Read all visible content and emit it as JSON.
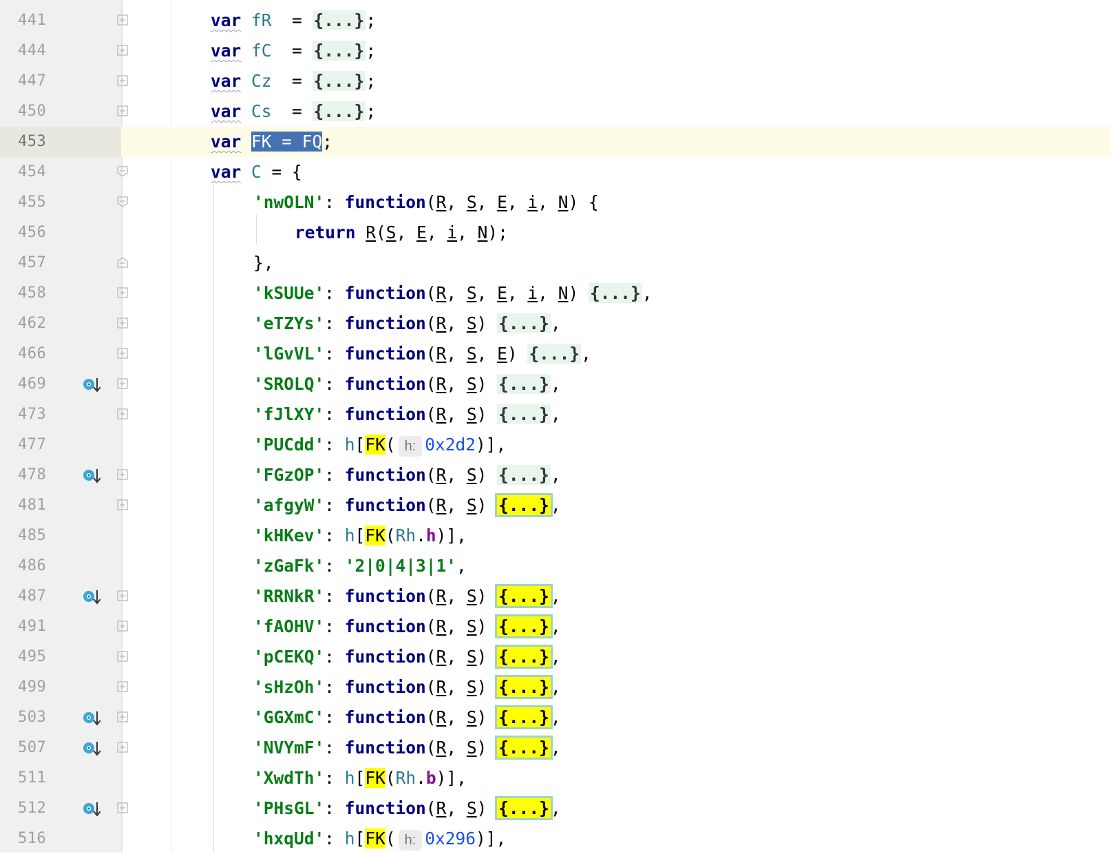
{
  "lines": [
    {
      "num": "441",
      "tokens": [
        [
          "kw",
          "var"
        ],
        [
          "var",
          " fR"
        ],
        [
          "",
          "  = "
        ],
        [
          "fold",
          "{...}"
        ],
        [
          "",
          ";"
        ]
      ]
    },
    {
      "num": "444",
      "tokens": [
        [
          "kw",
          "var"
        ],
        [
          "var",
          " fC"
        ],
        [
          "",
          "  = "
        ],
        [
          "fold",
          "{...}"
        ],
        [
          "",
          ";"
        ]
      ]
    },
    {
      "num": "447",
      "tokens": [
        [
          "kw",
          "var"
        ],
        [
          "var",
          " Cz"
        ],
        [
          "",
          "  = "
        ],
        [
          "fold",
          "{...}"
        ],
        [
          "",
          ";"
        ]
      ]
    },
    {
      "num": "450",
      "tokens": [
        [
          "kw",
          "var"
        ],
        [
          "var",
          " Cs"
        ],
        [
          "",
          "  = "
        ],
        [
          "fold",
          "{...}"
        ],
        [
          "",
          ";"
        ]
      ]
    },
    {
      "num": "453",
      "current": true,
      "tokens": [
        [
          "kw",
          "var"
        ],
        [
          "",
          " "
        ],
        [
          "sel",
          "FK = FQ"
        ],
        [
          "",
          ";"
        ]
      ]
    },
    {
      "num": "454",
      "tokens": [
        [
          "kw",
          "var"
        ],
        [
          "var",
          " C"
        ],
        [
          "",
          " = {"
        ]
      ]
    },
    {
      "num": "455",
      "indent": 1,
      "tokens": [
        [
          "str",
          "'nwOLN'"
        ],
        [
          "",
          ": "
        ],
        [
          "kw",
          "function"
        ],
        [
          "",
          "("
        ],
        [
          "param",
          "R"
        ],
        [
          "",
          ", "
        ],
        [
          "param",
          "S"
        ],
        [
          "",
          ", "
        ],
        [
          "param",
          "E"
        ],
        [
          "",
          ", "
        ],
        [
          "param",
          "i"
        ],
        [
          "",
          ", "
        ],
        [
          "param",
          "N"
        ],
        [
          "",
          ") {"
        ]
      ]
    },
    {
      "num": "456",
      "indent": 2,
      "tokens": [
        [
          "kw",
          "return "
        ],
        [
          "param",
          "R"
        ],
        [
          "",
          "("
        ],
        [
          "param",
          "S"
        ],
        [
          "",
          ", "
        ],
        [
          "param",
          "E"
        ],
        [
          "",
          ", "
        ],
        [
          "param",
          "i"
        ],
        [
          "",
          ", "
        ],
        [
          "param",
          "N"
        ],
        [
          "",
          ");"
        ]
      ]
    },
    {
      "num": "457",
      "indent": 1,
      "tokens": [
        [
          "",
          "},"
        ]
      ]
    },
    {
      "num": "458",
      "indent": 1,
      "tokens": [
        [
          "str",
          "'kSUUe'"
        ],
        [
          "",
          ": "
        ],
        [
          "kw",
          "function"
        ],
        [
          "",
          "("
        ],
        [
          "param",
          "R"
        ],
        [
          "",
          ", "
        ],
        [
          "param",
          "S"
        ],
        [
          "",
          ", "
        ],
        [
          "param",
          "E"
        ],
        [
          "",
          ", "
        ],
        [
          "param",
          "i"
        ],
        [
          "",
          ", "
        ],
        [
          "param",
          "N"
        ],
        [
          "",
          ") "
        ],
        [
          "fold",
          "{...}"
        ],
        [
          "",
          ","
        ]
      ]
    },
    {
      "num": "462",
      "indent": 1,
      "tokens": [
        [
          "str",
          "'eTZYs'"
        ],
        [
          "",
          ": "
        ],
        [
          "kw",
          "function"
        ],
        [
          "",
          "("
        ],
        [
          "param",
          "R"
        ],
        [
          "",
          ", "
        ],
        [
          "param",
          "S"
        ],
        [
          "",
          ") "
        ],
        [
          "fold",
          "{...}"
        ],
        [
          "",
          ","
        ]
      ]
    },
    {
      "num": "466",
      "indent": 1,
      "tokens": [
        [
          "str",
          "'lGvVL'"
        ],
        [
          "",
          ": "
        ],
        [
          "kw",
          "function"
        ],
        [
          "",
          "("
        ],
        [
          "param",
          "R"
        ],
        [
          "",
          ", "
        ],
        [
          "param",
          "S"
        ],
        [
          "",
          ", "
        ],
        [
          "param",
          "E"
        ],
        [
          "",
          ") "
        ],
        [
          "fold",
          "{...}"
        ],
        [
          "",
          ","
        ]
      ]
    },
    {
      "num": "469",
      "bookmark": true,
      "indent": 1,
      "tokens": [
        [
          "str",
          "'SROLQ'"
        ],
        [
          "",
          ": "
        ],
        [
          "kw",
          "function"
        ],
        [
          "",
          "("
        ],
        [
          "param",
          "R"
        ],
        [
          "",
          ", "
        ],
        [
          "param",
          "S"
        ],
        [
          "",
          ") "
        ],
        [
          "fold",
          "{...}"
        ],
        [
          "",
          ","
        ]
      ]
    },
    {
      "num": "473",
      "indent": 1,
      "tokens": [
        [
          "str",
          "'fJlXY'"
        ],
        [
          "",
          ": "
        ],
        [
          "kw",
          "function"
        ],
        [
          "",
          "("
        ],
        [
          "param",
          "R"
        ],
        [
          "",
          ", "
        ],
        [
          "param",
          "S"
        ],
        [
          "",
          ") "
        ],
        [
          "fold",
          "{...}"
        ],
        [
          "",
          ","
        ]
      ]
    },
    {
      "num": "477",
      "indent": 1,
      "tokens": [
        [
          "str",
          "'PUCdd'"
        ],
        [
          "",
          ": "
        ],
        [
          "var",
          "h"
        ],
        [
          "",
          "["
        ],
        [
          "hl",
          "FK"
        ],
        [
          "",
          "("
        ],
        [
          "hint",
          "h:"
        ],
        [
          "num",
          "0x2d2"
        ],
        [
          "",
          ")],"
        ]
      ]
    },
    {
      "num": "478",
      "bookmark": true,
      "indent": 1,
      "tokens": [
        [
          "str",
          "'FGzOP'"
        ],
        [
          "",
          ": "
        ],
        [
          "kw",
          "function"
        ],
        [
          "",
          "("
        ],
        [
          "param",
          "R"
        ],
        [
          "",
          ", "
        ],
        [
          "param",
          "S"
        ],
        [
          "",
          ") "
        ],
        [
          "fold",
          "{...}"
        ],
        [
          "",
          ","
        ]
      ]
    },
    {
      "num": "481",
      "indent": 1,
      "tokens": [
        [
          "str",
          "'afgyW'"
        ],
        [
          "",
          ": "
        ],
        [
          "kw",
          "function"
        ],
        [
          "",
          "("
        ],
        [
          "param",
          "R"
        ],
        [
          "",
          ", "
        ],
        [
          "param",
          "S"
        ],
        [
          "",
          ") "
        ],
        [
          "foldhl",
          "{...}"
        ],
        [
          "",
          ","
        ]
      ]
    },
    {
      "num": "485",
      "indent": 1,
      "tokens": [
        [
          "str",
          "'kHKev'"
        ],
        [
          "",
          ": "
        ],
        [
          "var",
          "h"
        ],
        [
          "",
          "["
        ],
        [
          "hl",
          "FK"
        ],
        [
          "",
          "("
        ],
        [
          "var",
          "Rh"
        ],
        [
          "",
          "."
        ],
        [
          "prop",
          "h"
        ],
        [
          "",
          ")],"
        ]
      ]
    },
    {
      "num": "486",
      "indent": 1,
      "tokens": [
        [
          "str",
          "'zGaFk'"
        ],
        [
          "",
          ": "
        ],
        [
          "str",
          "'2|0|4|3|1'"
        ],
        [
          "",
          ","
        ]
      ]
    },
    {
      "num": "487",
      "bookmark": true,
      "indent": 1,
      "tokens": [
        [
          "str",
          "'RRNkR'"
        ],
        [
          "",
          ": "
        ],
        [
          "kw",
          "function"
        ],
        [
          "",
          "("
        ],
        [
          "param",
          "R"
        ],
        [
          "",
          ", "
        ],
        [
          "param",
          "S"
        ],
        [
          "",
          ") "
        ],
        [
          "foldhl",
          "{...}"
        ],
        [
          "",
          ","
        ]
      ]
    },
    {
      "num": "491",
      "indent": 1,
      "tokens": [
        [
          "str",
          "'fAOHV'"
        ],
        [
          "",
          ": "
        ],
        [
          "kw",
          "function"
        ],
        [
          "",
          "("
        ],
        [
          "param",
          "R"
        ],
        [
          "",
          ", "
        ],
        [
          "param",
          "S"
        ],
        [
          "",
          ") "
        ],
        [
          "foldhl",
          "{...}"
        ],
        [
          "",
          ","
        ]
      ]
    },
    {
      "num": "495",
      "indent": 1,
      "tokens": [
        [
          "str",
          "'pCEKQ'"
        ],
        [
          "",
          ": "
        ],
        [
          "kw",
          "function"
        ],
        [
          "",
          "("
        ],
        [
          "param",
          "R"
        ],
        [
          "",
          ", "
        ],
        [
          "param",
          "S"
        ],
        [
          "",
          ") "
        ],
        [
          "foldhl",
          "{...}"
        ],
        [
          "",
          ","
        ]
      ]
    },
    {
      "num": "499",
      "indent": 1,
      "tokens": [
        [
          "str",
          "'sHzOh'"
        ],
        [
          "",
          ": "
        ],
        [
          "kw",
          "function"
        ],
        [
          "",
          "("
        ],
        [
          "param",
          "R"
        ],
        [
          "",
          ", "
        ],
        [
          "param",
          "S"
        ],
        [
          "",
          ") "
        ],
        [
          "foldhl",
          "{...}"
        ],
        [
          "",
          ","
        ]
      ]
    },
    {
      "num": "503",
      "bookmark": true,
      "indent": 1,
      "tokens": [
        [
          "str",
          "'GGXmC'"
        ],
        [
          "",
          ": "
        ],
        [
          "kw",
          "function"
        ],
        [
          "",
          "("
        ],
        [
          "param",
          "R"
        ],
        [
          "",
          ", "
        ],
        [
          "param",
          "S"
        ],
        [
          "",
          ") "
        ],
        [
          "foldhl",
          "{...}"
        ],
        [
          "",
          ","
        ]
      ]
    },
    {
      "num": "507",
      "bookmark": true,
      "indent": 1,
      "tokens": [
        [
          "str",
          "'NVYmF'"
        ],
        [
          "",
          ": "
        ],
        [
          "kw",
          "function"
        ],
        [
          "",
          "("
        ],
        [
          "param",
          "R"
        ],
        [
          "",
          ", "
        ],
        [
          "param",
          "S"
        ],
        [
          "",
          ") "
        ],
        [
          "foldhl",
          "{...}"
        ],
        [
          "",
          ","
        ]
      ]
    },
    {
      "num": "511",
      "indent": 1,
      "tokens": [
        [
          "str",
          "'XwdTh'"
        ],
        [
          "",
          ": "
        ],
        [
          "var",
          "h"
        ],
        [
          "",
          "["
        ],
        [
          "hl",
          "FK"
        ],
        [
          "",
          "("
        ],
        [
          "var",
          "Rh"
        ],
        [
          "",
          "."
        ],
        [
          "prop",
          "b"
        ],
        [
          "",
          ")],"
        ]
      ]
    },
    {
      "num": "512",
      "bookmark": true,
      "indent": 1,
      "tokens": [
        [
          "str",
          "'PHsGL'"
        ],
        [
          "",
          ": "
        ],
        [
          "kw",
          "function"
        ],
        [
          "",
          "("
        ],
        [
          "param",
          "R"
        ],
        [
          "",
          ", "
        ],
        [
          "param",
          "S"
        ],
        [
          "",
          ") "
        ],
        [
          "foldhl",
          "{...}"
        ],
        [
          "",
          ","
        ]
      ]
    },
    {
      "num": "516",
      "indent": 1,
      "tokens": [
        [
          "str",
          "'hxqUd'"
        ],
        [
          "",
          ": "
        ],
        [
          "var",
          "h"
        ],
        [
          "",
          "["
        ],
        [
          "hl",
          "FK"
        ],
        [
          "",
          "("
        ],
        [
          "hint",
          "h:"
        ],
        [
          "num",
          "0x296"
        ],
        [
          "",
          ")],"
        ]
      ]
    }
  ],
  "folds": {
    "441": "plus",
    "444": "plus",
    "447": "plus",
    "450": "plus",
    "454": "open",
    "455": "open",
    "457": "close",
    "458": "plus",
    "462": "plus",
    "466": "plus",
    "469": "plus",
    "473": "plus",
    "478": "plus",
    "481": "plus",
    "487": "plus",
    "491": "plus",
    "495": "plus",
    "499": "plus",
    "503": "plus",
    "507": "plus",
    "512": "plus"
  },
  "colors": {
    "keyword": "#000080",
    "string": "#067d17",
    "number": "#1750eb",
    "property": "#871094",
    "selection": "#4472b3",
    "highlight": "#ffff00",
    "bookmark": "#3aa7d6"
  }
}
